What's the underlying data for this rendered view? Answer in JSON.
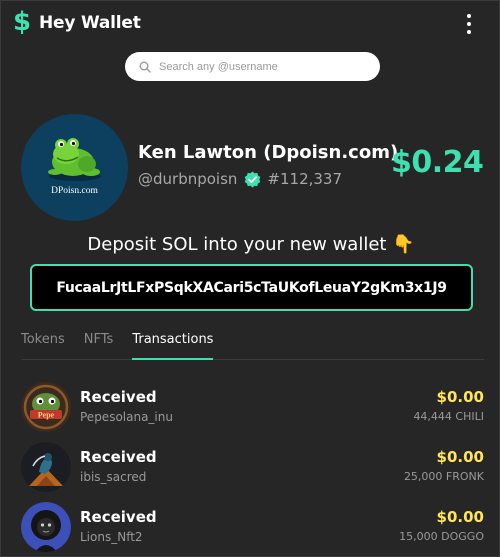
{
  "app": {
    "logo_symbol": "$",
    "title": "Hey Wallet",
    "accent_color": "#3ee0b0",
    "amount_color": "#ffe45c"
  },
  "search": {
    "placeholder": "Search any @username"
  },
  "profile": {
    "avatar_caption": "DPoisn.com",
    "name": "Ken Lawton (Dpoisn.com)",
    "handle": "@durbnpoisn",
    "number": "#112,337",
    "verified_icon": "verified-check-icon",
    "balance": "$0.24"
  },
  "deposit": {
    "text": "Deposit SOL into your new wallet 👇",
    "address": "FucaaLrJtLFxPSqkXACari5cTaUKofLeuaY2gKm3x1J9"
  },
  "tabs": [
    {
      "label": "Tokens",
      "active": false
    },
    {
      "label": "NFTs",
      "active": false
    },
    {
      "label": "Transactions",
      "active": true
    }
  ],
  "transactions": [
    {
      "type": "Received",
      "user": "Pepesolana_inu",
      "amount": "$0.00",
      "token": "44,444 CHILI",
      "avatar_icon": "pepe-avatar"
    },
    {
      "type": "Received",
      "user": "ibis_sacred",
      "amount": "$0.00",
      "token": "25,000 FRONK",
      "avatar_icon": "ibis-avatar"
    },
    {
      "type": "Received",
      "user": "Lions_Nft2",
      "amount": "$0.00",
      "token": "15,000 DOGGO",
      "avatar_icon": "lion-avatar"
    }
  ]
}
